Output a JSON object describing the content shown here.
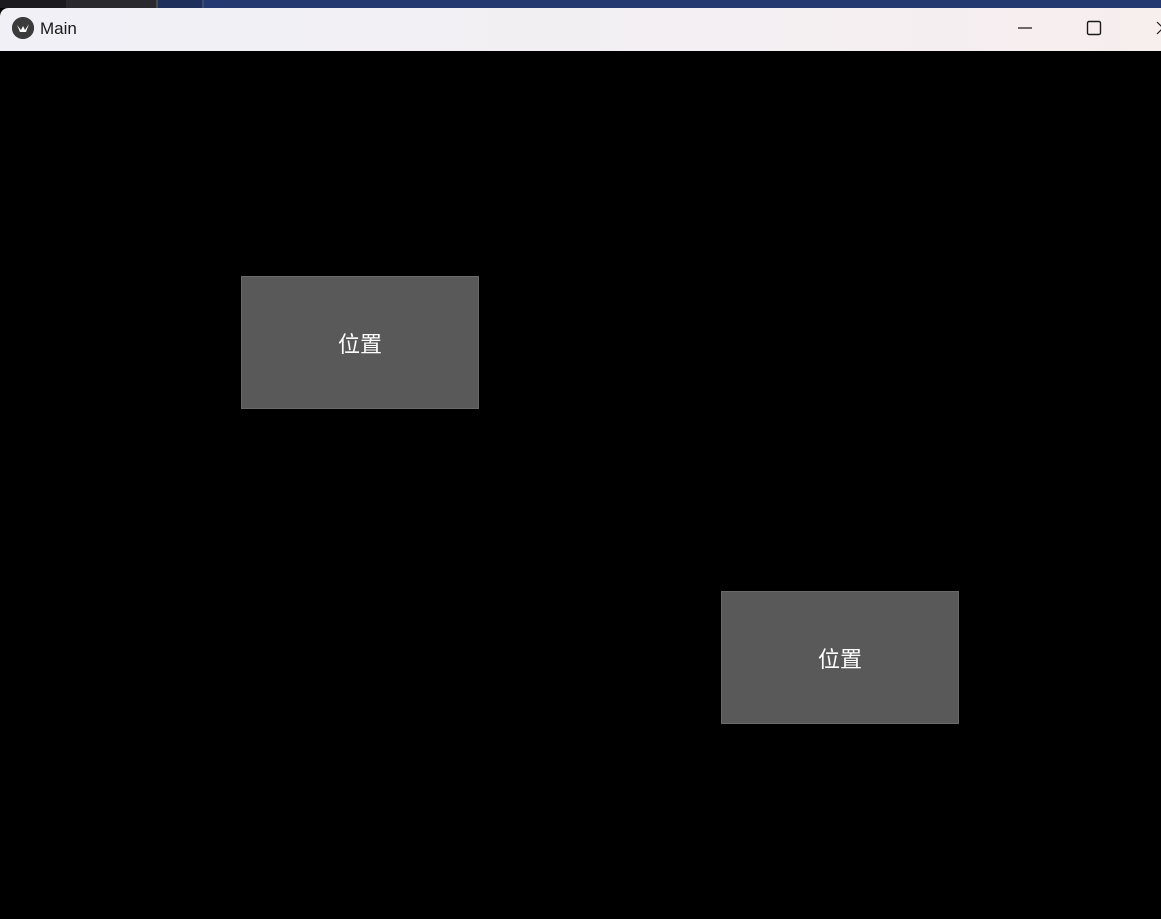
{
  "window": {
    "title": "Main",
    "app_icon": "kivy-logo-icon",
    "controls": {
      "minimize_icon": "minimize-icon",
      "maximize_icon": "maximize-icon",
      "close_icon": "close-icon"
    }
  },
  "client": {
    "background": "#000000",
    "buttons": [
      {
        "label": "位置",
        "color": "#595959"
      },
      {
        "label": "位置",
        "color": "#595959"
      }
    ]
  }
}
